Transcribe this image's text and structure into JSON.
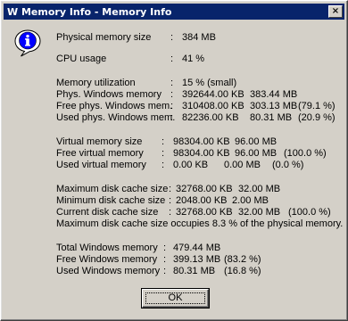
{
  "window": {
    "title": "W Memory Info - Memory Info",
    "close_label": "×"
  },
  "icon": {
    "name": "info-icon",
    "glyph": "i"
  },
  "rows": {
    "physical_memory_size": {
      "label": "Physical memory size",
      "sep": ":",
      "value": "384 MB"
    },
    "cpu_usage": {
      "label": "CPU usage",
      "sep": ":",
      "value": "41 %"
    },
    "memory_utilization": {
      "label": "Memory utilization",
      "sep": ":",
      "value": "15 %  (small)"
    },
    "phys_windows_memory": {
      "label": "Phys. Windows memory",
      "sep": ":",
      "kb": "392644.00 KB",
      "mb": "383.44 MB",
      "pct": ""
    },
    "free_phys_windows_memory": {
      "label": "Free phys. Windows mem.",
      "sep": ":",
      "kb": "310408.00 KB",
      "mb": "303.13 MB",
      "pct": "(79.1 %)"
    },
    "used_phys_windows_memory": {
      "label": "Used phys. Windows mem.",
      "sep": ":",
      "kb": "82236.00 KB",
      "mb": "80.31 MB",
      "pct": "(20.9 %)"
    },
    "virtual_memory_size": {
      "label": "Virtual memory size",
      "sep": ":",
      "kb": "98304.00 KB",
      "mb": "96.00 MB",
      "pct": ""
    },
    "free_virtual_memory": {
      "label": "Free virtual memory",
      "sep": ":",
      "kb": "98304.00 KB",
      "mb": "96.00 MB",
      "pct": "(100.0 %)"
    },
    "used_virtual_memory": {
      "label": "Used virtual memory",
      "sep": ":",
      "kb": "0.00 KB",
      "mb": "0.00 MB",
      "pct": "(0.0 %)"
    },
    "max_disk_cache_size": {
      "label": "Maximum disk cache size",
      "sep": ":",
      "kb": "32768.00 KB",
      "mb": "32.00 MB",
      "pct": ""
    },
    "min_disk_cache_size": {
      "label": "Minimum disk cache size",
      "sep": ":",
      "kb": "2048.00 KB",
      "mb": "2.00 MB",
      "pct": ""
    },
    "current_disk_cache_size": {
      "label": "Current disk cache size",
      "sep": ":",
      "kb": "32768.00 KB",
      "mb": "32.00 MB",
      "pct": "(100.0 %)"
    },
    "disk_cache_note": "Maximum disk cache size occupies 8.3 % of the physical memory.",
    "total_windows_memory": {
      "label": "Total Windows memory",
      "sep": ":",
      "mb": "479.44 MB",
      "pct": ""
    },
    "free_windows_memory": {
      "label": "Free Windows memory",
      "sep": ":",
      "mb": "399.13 MB",
      "pct": "(83.2 %)"
    },
    "used_windows_memory": {
      "label": "Used Windows memory",
      "sep": ":",
      "mb": "80.31 MB",
      "pct": "(16.8 %)"
    }
  },
  "buttons": {
    "ok_label": "OK"
  }
}
